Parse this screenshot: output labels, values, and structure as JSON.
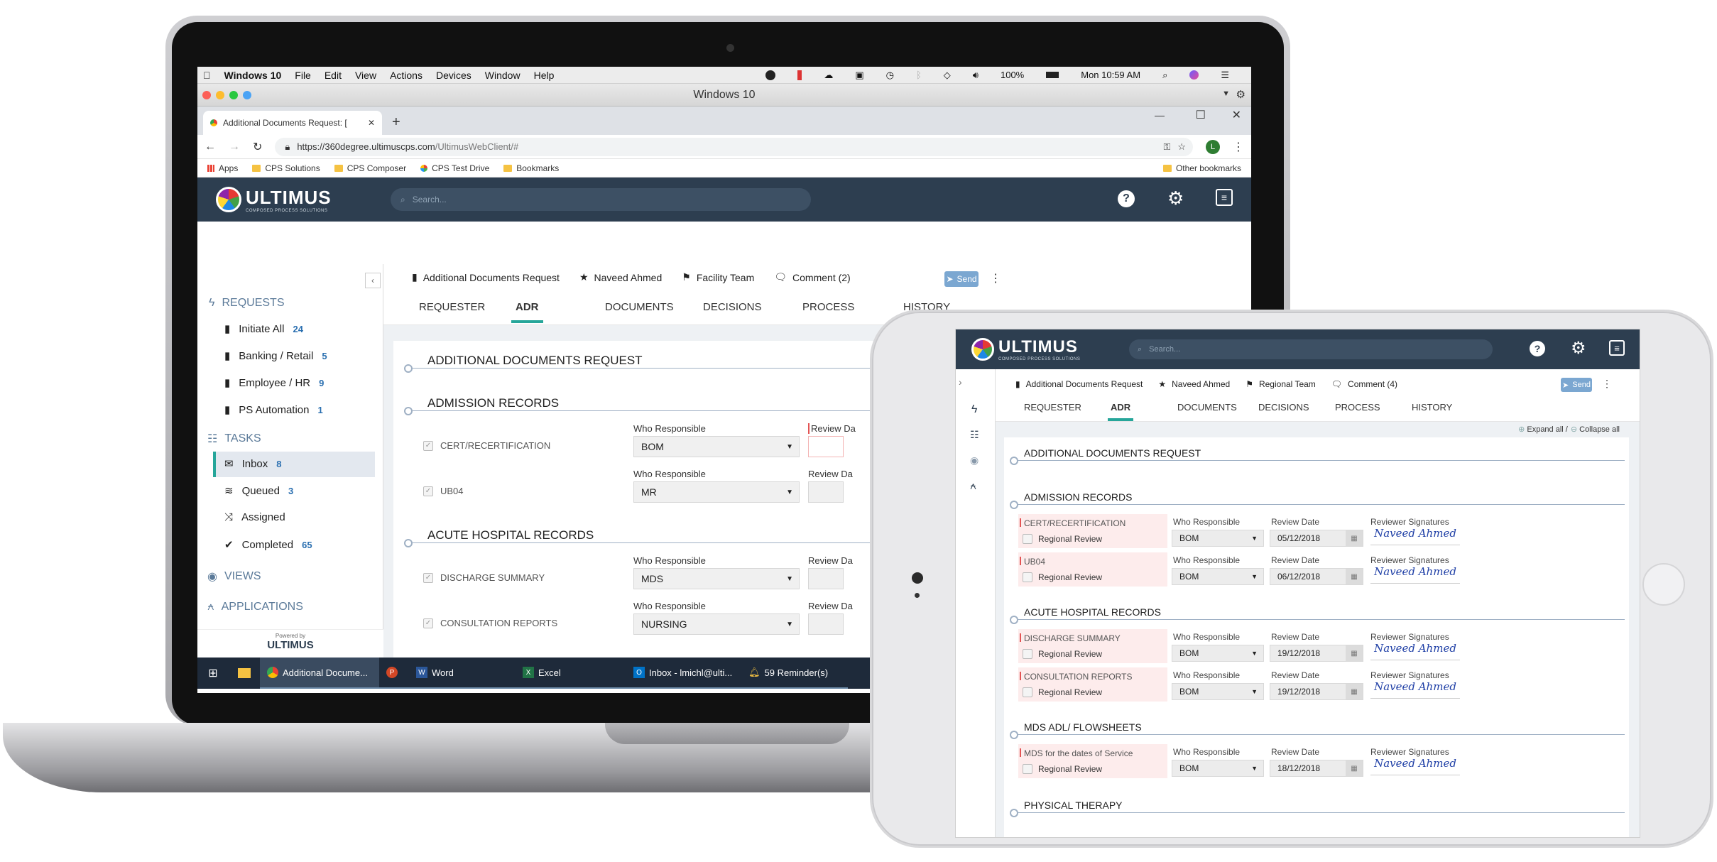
{
  "laptop": {
    "mac": {
      "menu": [
        "Windows 10",
        "File",
        "Edit",
        "View",
        "Actions",
        "Devices",
        "Window",
        "Help"
      ],
      "battery": "100%",
      "clock": "Mon 10:59 AM"
    },
    "window_title": "Windows 10",
    "browser": {
      "tab_title": "Additional Documents Request: [",
      "url_host": "https://360degree.ultimuscps.com",
      "url_path": "/UltimusWebClient/#",
      "avatar_letter": "L",
      "bookmarks": [
        "Apps",
        "CPS Solutions",
        "CPS Composer",
        "CPS Test Drive",
        "Bookmarks"
      ],
      "other_bookmarks": "Other bookmarks"
    },
    "app": {
      "logo": "ULTIMUS",
      "logo_tag": "COMPOSED PROCESS SOLUTIONS",
      "search_placeholder": "Search...",
      "sidebar": {
        "requests_label": "REQUESTS",
        "requests": [
          {
            "label": "Initiate All",
            "count": "24"
          },
          {
            "label": "Banking / Retail",
            "count": "5"
          },
          {
            "label": "Employee / HR",
            "count": "9"
          },
          {
            "label": "PS Automation",
            "count": "1"
          }
        ],
        "tasks_label": "TASKS",
        "tasks": [
          {
            "label": "Inbox",
            "count": "8"
          },
          {
            "label": "Queued",
            "count": "3"
          },
          {
            "label": "Assigned",
            "count": ""
          },
          {
            "label": "Completed",
            "count": "65"
          }
        ],
        "views_label": "VIEWS",
        "applications_label": "APPLICATIONS",
        "powered_by": "Powered by",
        "powered_logo": "ULTIMUS"
      },
      "toolbar": {
        "form": "Additional Documents Request",
        "user": "Naveed Ahmed",
        "team": "Facility Team",
        "comment": "Comment (2)",
        "send": "Send"
      },
      "tabs": [
        "REQUESTER",
        "ADR",
        "DOCUMENTS",
        "DECISIONS",
        "PROCESS",
        "HISTORY"
      ],
      "sections": {
        "adr": "ADDITIONAL DOCUMENTS REQUEST",
        "admission": "ADMISSION RECORDS",
        "acute": "ACUTE HOSPITAL RECORDS"
      },
      "who_label": "Who Responsible",
      "review_label": "Review Da",
      "rows": [
        {
          "label": "CERT/RECERTIFICATION",
          "who": "BOM"
        },
        {
          "label": "UB04",
          "who": "MR"
        },
        {
          "label": "DISCHARGE SUMMARY",
          "who": "MDS"
        },
        {
          "label": "CONSULTATION REPORTS",
          "who": "NURSING"
        }
      ]
    },
    "taskbar": [
      "Additional Docume...",
      "Word",
      "Excel",
      "Inbox - lmichl@ulti...",
      "59 Reminder(s)"
    ]
  },
  "tablet": {
    "logo": "ULTIMUS",
    "logo_tag": "COMPOSED PROCESS SOLUTIONS",
    "search_placeholder": "Search...",
    "toolbar": {
      "form": "Additional Documents Request",
      "user": "Naveed Ahmed",
      "team": "Regional Team",
      "comment": "Comment (4)",
      "send": "Send"
    },
    "tabs": [
      "REQUESTER",
      "ADR",
      "DOCUMENTS",
      "DECISIONS",
      "PROCESS",
      "HISTORY"
    ],
    "expand": "Expand all /",
    "collapse": "Collapse all",
    "sections": {
      "adr": "ADDITIONAL DOCUMENTS REQUEST",
      "admission": "ADMISSION RECORDS",
      "acute": "ACUTE HOSPITAL RECORDS",
      "mds": "MDS ADL/ FLOWSHEETS",
      "pt": "PHYSICAL THERAPY"
    },
    "who_label": "Who Responsible",
    "review_label": "Review Date",
    "sig_label": "Reviewer Signatures",
    "sub_label": "Regional Review",
    "rows": [
      {
        "label": "CERT/RECERTIFICATION",
        "who": "BOM",
        "date": "05/12/2018",
        "sig": "Naveed Ahmed"
      },
      {
        "label": "UB04",
        "who": "BOM",
        "date": "06/12/2018",
        "sig": "Naveed Ahmed"
      },
      {
        "label": "DISCHARGE SUMMARY",
        "who": "BOM",
        "date": "19/12/2018",
        "sig": "Naveed Ahmed"
      },
      {
        "label": "CONSULTATION REPORTS",
        "who": "BOM",
        "date": "19/12/2018",
        "sig": "Naveed Ahmed"
      },
      {
        "label": "MDS for the dates of Service",
        "who": "BOM",
        "date": "18/12/2018",
        "sig": "Naveed Ahmed"
      }
    ]
  }
}
